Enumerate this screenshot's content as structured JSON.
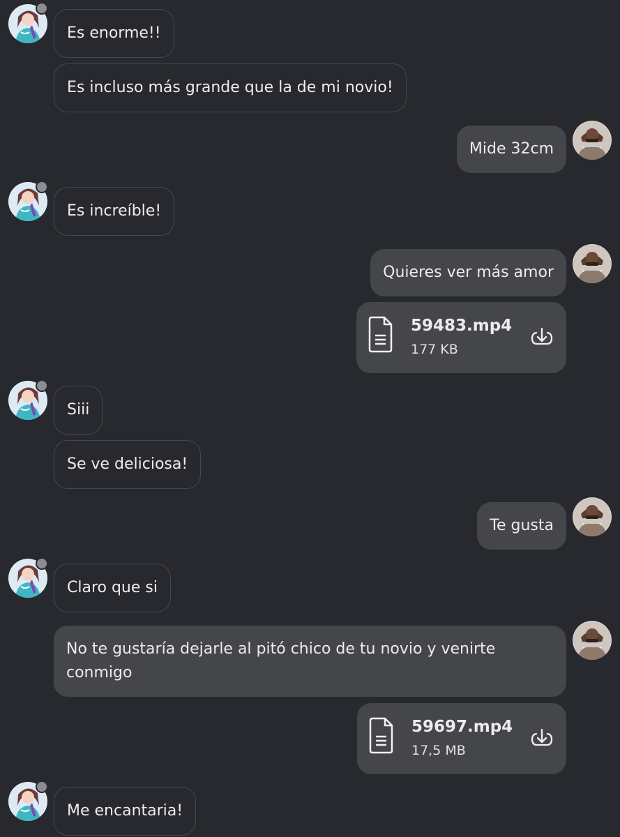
{
  "colors": {
    "background": "#28292e",
    "incoming_bubble_border": "#47484d",
    "outgoing_bubble": "#45464a",
    "text": "#ececee",
    "status_dot": "#8c8d92"
  },
  "messages": [
    {
      "side": "in",
      "text": "Es enorme!!"
    },
    {
      "side": "in",
      "text": "Es incluso más grande que la de mi novio!"
    },
    {
      "side": "out",
      "text": "Mide 32cm"
    },
    {
      "side": "in",
      "text": "Es increíble!"
    },
    {
      "side": "out",
      "text": "Quieres ver más amor"
    },
    {
      "side": "out",
      "type": "file",
      "file_name": "59483.mp4",
      "file_size": "177 KB",
      "icons": [
        "document-icon",
        "download-icon"
      ]
    },
    {
      "side": "in",
      "text": "Siii"
    },
    {
      "side": "in",
      "text": "Se ve deliciosa!"
    },
    {
      "side": "out",
      "text": "Te gusta"
    },
    {
      "side": "in",
      "text": "Claro que si"
    },
    {
      "side": "out",
      "text": "No te gustaría dejarle al pitó chico de tu novio y venirte conmigo"
    },
    {
      "side": "out",
      "type": "file",
      "file_name": "59697.mp4",
      "file_size": "17,5 MB",
      "icons": [
        "document-icon",
        "download-icon"
      ]
    },
    {
      "side": "in",
      "text": "Me encantaria!"
    }
  ]
}
